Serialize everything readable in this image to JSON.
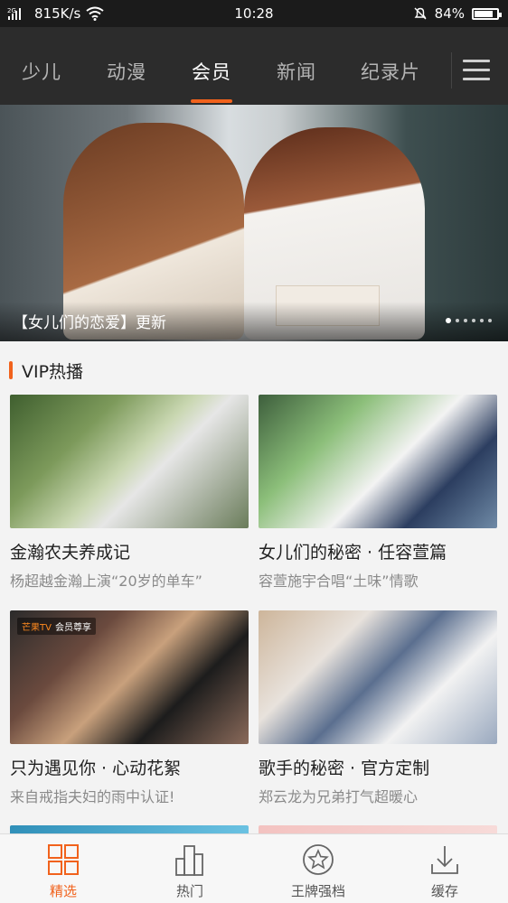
{
  "status_bar": {
    "network": "2G",
    "speed": "815K/s",
    "time": "10:28",
    "battery": "84%",
    "battery_level": 0.84
  },
  "channels": [
    {
      "label": "少儿",
      "active": false
    },
    {
      "label": "动漫",
      "active": false
    },
    {
      "label": "会员",
      "active": true
    },
    {
      "label": "新闻",
      "active": false
    },
    {
      "label": "纪录片",
      "active": false
    }
  ],
  "banner": {
    "caption": "【女儿们的恋爱】更新",
    "page_count": 6,
    "current_page": 1
  },
  "section": {
    "title": "VIP热播"
  },
  "cards": [
    {
      "title": "金瀚农夫养成记",
      "subtitle": "杨超越金瀚上演“20岁的单车”"
    },
    {
      "title": "女儿们的秘密 · 任容萱篇",
      "subtitle": "容萱施宇合唱“土味”情歌"
    },
    {
      "title": "只为遇见你 · 心动花絮",
      "subtitle": "来自戒指夫妇的雨中认证!",
      "badge": "芒果TV",
      "badge_sub": "会员尊享"
    },
    {
      "title": "歌手的秘密 · 官方定制",
      "subtitle": "郑云龙为兄弟打气超暖心"
    }
  ],
  "bottom_nav": [
    {
      "label": "精选",
      "icon": "grid-icon",
      "active": true
    },
    {
      "label": "热门",
      "icon": "bar-chart-icon",
      "active": false
    },
    {
      "label": "王牌强档",
      "icon": "star-circle-icon",
      "active": false
    },
    {
      "label": "缓存",
      "icon": "download-icon",
      "active": false
    }
  ],
  "colors": {
    "accent": "#f1621c",
    "nav_bg": "#2c2c2c",
    "status_bg": "#1b1b1b"
  }
}
